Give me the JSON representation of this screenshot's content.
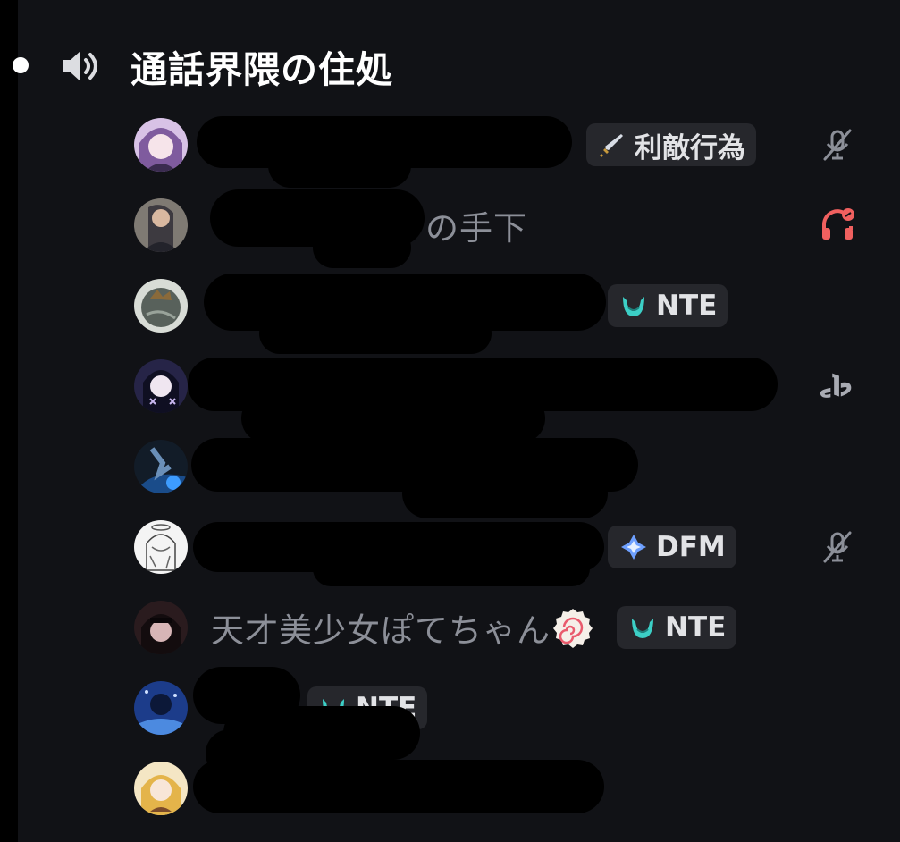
{
  "channel": {
    "name": "通話界隈の住処",
    "icon": "speaker-icon"
  },
  "members": [
    {
      "name": "",
      "badge": {
        "icon": "sword-icon",
        "label": "利敵行為"
      },
      "status_icon": "muted-mic-icon",
      "colors": {
        "avatar": [
          "#c9a3d9",
          "#6a4f86"
        ]
      }
    },
    {
      "name": "の手下",
      "badge": null,
      "status_icon": "deafened-headset-icon",
      "colors": {
        "avatar": [
          "#b99a86",
          "#3b3b47"
        ]
      }
    },
    {
      "name": "",
      "badge": {
        "icon": "nte-icon",
        "label": "NTE"
      },
      "status_icon": null,
      "colors": {
        "avatar": [
          "#8b918a",
          "#3b433f"
        ]
      }
    },
    {
      "name": "",
      "badge": null,
      "status_icon": "playstation-icon",
      "colors": {
        "avatar": [
          "#5a4e8a",
          "#161633"
        ]
      }
    },
    {
      "name": "",
      "badge": null,
      "status_icon": null,
      "colors": {
        "avatar": [
          "#31415c",
          "#0a1a2a"
        ]
      }
    },
    {
      "name": "",
      "badge": {
        "icon": "dfm-icon",
        "label": "DFM"
      },
      "status_icon": "muted-mic-icon",
      "colors": {
        "avatar": [
          "#f2f2f2",
          "#8a8a8a"
        ]
      }
    },
    {
      "name": "天才美少女ぽてちゃん",
      "badge": {
        "icon": "nte-icon",
        "label": "NTE"
      },
      "status_icon": null,
      "colors": {
        "avatar": [
          "#6b4a4f",
          "#1c1416"
        ]
      }
    },
    {
      "name": "",
      "badge": {
        "icon": "nte-icon",
        "label": "NTE"
      },
      "status_icon": null,
      "colors": {
        "avatar": [
          "#3a62b5",
          "#0d1c4a"
        ]
      }
    },
    {
      "name": "",
      "badge": null,
      "status_icon": null,
      "colors": {
        "avatar": [
          "#f0d48a",
          "#b07a3a"
        ]
      }
    }
  ],
  "colors": {
    "background": "#111216",
    "rail": "#000000",
    "badge_bg": "#26272c",
    "name_text": "#8c8f98",
    "muted_icon": "#8c8f98",
    "deafened_icon": "#f0605f",
    "nte_icon": "#3ccfc6"
  }
}
